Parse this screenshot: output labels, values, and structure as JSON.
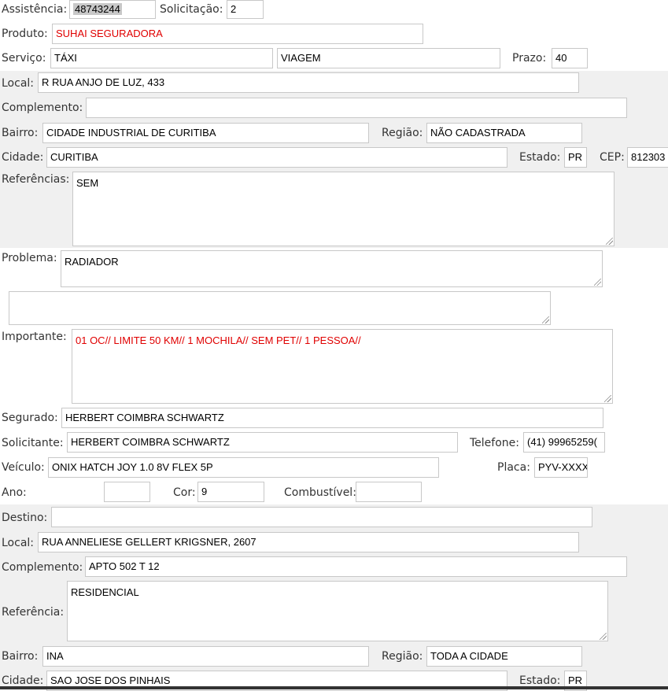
{
  "fields": {
    "assistencia": {
      "label": "Assistência:",
      "value": "48743244"
    },
    "solicitacao": {
      "label": "Solicitação:",
      "value": "2"
    },
    "produto": {
      "label": "Produto:",
      "value": "SUHAI SEGURADORA"
    },
    "servico": {
      "label": "Serviço:",
      "value": "TÁXI",
      "value2": "VIAGEM"
    },
    "prazo": {
      "label": "Prazo:",
      "value": "40"
    },
    "local": {
      "label": "Local:",
      "value": "R RUA ANJO DE LUZ, 433"
    },
    "complemento": {
      "label": "Complemento:",
      "value": ""
    },
    "bairro": {
      "label": "Bairro:",
      "value": "CIDADE INDUSTRIAL DE CURITIBA"
    },
    "regiao": {
      "label": "Região:",
      "value": "NÃO CADASTRADA"
    },
    "cidade": {
      "label": "Cidade:",
      "value": "CURITIBA"
    },
    "estado": {
      "label": "Estado:",
      "value": "PR"
    },
    "cep": {
      "label": "CEP:",
      "value": "812303"
    },
    "referencias": {
      "label": "Referências:",
      "value": "SEM"
    },
    "problema": {
      "label": "Problema:",
      "value": "RADIADOR",
      "value2": ""
    },
    "importante": {
      "label": "Importante:",
      "value": "01 OC// LIMITE 50 KM// 1 MOCHILA// SEM PET// 1 PESSOA//"
    },
    "segurado": {
      "label": "Segurado:",
      "value": "HERBERT COIMBRA SCHWARTZ"
    },
    "solicitante": {
      "label": "Solicitante:",
      "value": "HERBERT COIMBRA SCHWARTZ"
    },
    "telefone": {
      "label": "Telefone:",
      "value": "(41) 99965259("
    },
    "veiculo": {
      "label": "Veículo:",
      "value": "ONIX HATCH JOY 1.0 8V FLEX 5P"
    },
    "placa": {
      "label": "Placa:",
      "value": "PYV-XXXX"
    },
    "ano": {
      "label": "Ano:",
      "value": ""
    },
    "cor": {
      "label": "Cor:",
      "value": "9"
    },
    "combustivel": {
      "label": "Combustível:",
      "value": ""
    }
  },
  "destino": {
    "destino": {
      "label": "Destino:",
      "value": ""
    },
    "local": {
      "label": "Local:",
      "value": "RUA ANNELIESE GELLERT KRIGSNER, 2607"
    },
    "complemento": {
      "label": "Complemento:",
      "value": "APTO 502 T 12"
    },
    "referencia": {
      "label": "Referência:",
      "value": "RESIDENCIAL"
    },
    "bairro": {
      "label": "Bairro:",
      "value": "INA"
    },
    "regiao": {
      "label": "Região:",
      "value": "TODA A CIDADE"
    },
    "cidade": {
      "label": "Cidade:",
      "value": "SAO JOSE DOS PINHAIS"
    },
    "estado": {
      "label": "Estado:",
      "value": "PR"
    }
  },
  "colors": {
    "highlight_text": "#e00000",
    "band_grey": "#f0f0f0"
  }
}
